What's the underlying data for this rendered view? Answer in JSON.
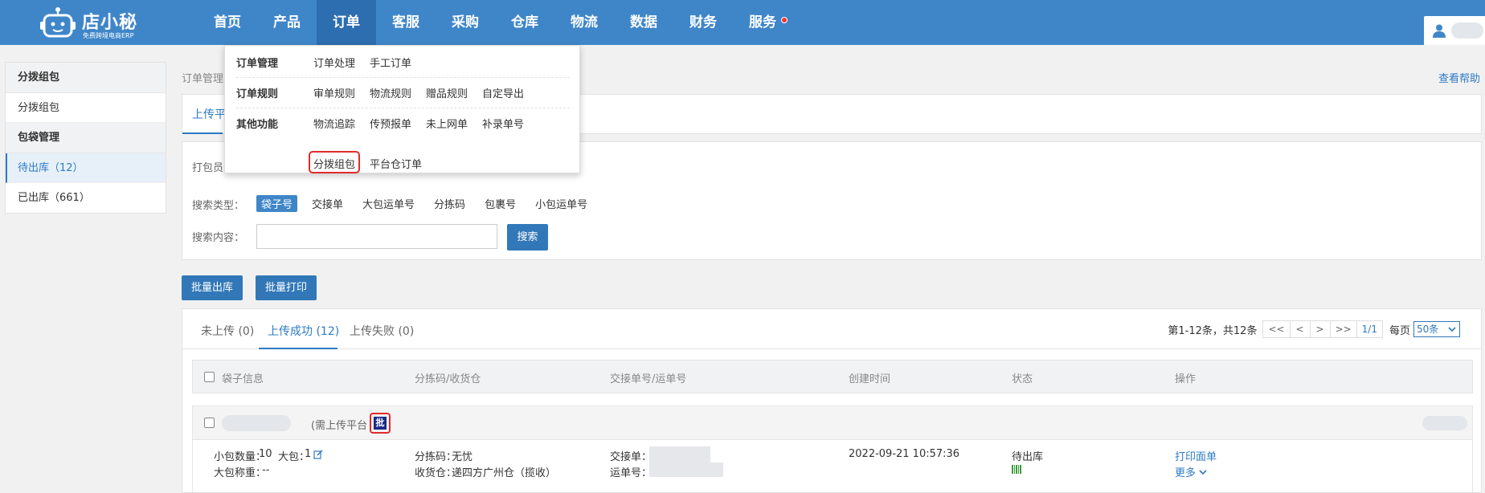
{
  "app": {
    "logo_title": "店小秘",
    "logo_subtitle": "免费跨境电商ERP"
  },
  "nav": {
    "items": [
      "首页",
      "产品",
      "订单",
      "客服",
      "采购",
      "仓库",
      "物流",
      "数据",
      "财务",
      "服务"
    ],
    "active": "订单"
  },
  "dropdown": {
    "sections": [
      {
        "title": "订单管理",
        "links": [
          "订单处理",
          "手工订单"
        ]
      },
      {
        "title": "订单规则",
        "links": [
          "审单规则",
          "物流规则",
          "赠品规则",
          "自定导出"
        ]
      },
      {
        "title": "其他功能",
        "links": [
          "物流追踪",
          "传预报单",
          "未上网单",
          "补录单号",
          "分拨组包",
          "平台仓订单"
        ]
      }
    ],
    "highlighted": "分拨组包"
  },
  "sidebar": {
    "groups": [
      {
        "title": "分拨组包",
        "items": [
          {
            "label": "分拨组包"
          }
        ]
      },
      {
        "title": "包袋管理",
        "items": [
          {
            "label": "待出库（12）",
            "active": true
          },
          {
            "label": "已出库（661）"
          }
        ]
      }
    ]
  },
  "breadcrumb": "订单管理",
  "help_link": "查看帮助",
  "top_tab_label": "上传平",
  "filter": {
    "packer_label": "打包员",
    "search_type_label": "搜索类型：",
    "search_types": [
      "袋子号",
      "交接单",
      "大包运单号",
      "分拣码",
      "包裹号",
      "小包运单号"
    ],
    "search_type_selected": "袋子号",
    "search_content_label": "搜索内容：",
    "search_input_value": "",
    "search_button": "搜索"
  },
  "actions": {
    "batch_out": "批量出库",
    "batch_print": "批量打印"
  },
  "list_tabs": [
    {
      "label": "未上传 (0)"
    },
    {
      "label": "上传成功 (12)",
      "active": true
    },
    {
      "label": "上传失败 (0)"
    }
  ],
  "pagination": {
    "info": "第1-12条，共12条",
    "buttons": [
      "<<",
      "<",
      ">",
      ">>"
    ],
    "page": "1/1",
    "per_page_label": "每页",
    "per_page_value": "50条"
  },
  "table": {
    "headers": [
      "袋子信息",
      "分拣码/收货仓",
      "交接单号/运单号",
      "创建时间",
      "状态",
      "操作"
    ]
  },
  "row": {
    "note": "(需上传平台",
    "batch_badge": "批",
    "small_pkg_label": "小包数量：",
    "small_pkg_count": "10",
    "big_pkg_label": "大包：",
    "big_pkg_count": "1",
    "weight_label": "大包称重：",
    "weight_value": "--",
    "sort_code_label": "分拣码：",
    "sort_code_value": "无忧",
    "warehouse_label": "收货仓：",
    "warehouse_value": "递四方广州仓（揽收）",
    "handover_label": "交接单：",
    "waybill_label": "运单号：",
    "created_time": "2022-09-21 10:57:36",
    "status": "待出库",
    "action_print": "打印面单",
    "action_more": "更多"
  },
  "colors": {
    "header_bg": "#3f86c9",
    "accent": "#2d7bc4",
    "highlight_border": "#e02c2c"
  },
  "icons": [
    "robot-logo-icon",
    "user-icon",
    "edit-icon",
    "chevron-down-icon",
    "barcode-icon"
  ]
}
